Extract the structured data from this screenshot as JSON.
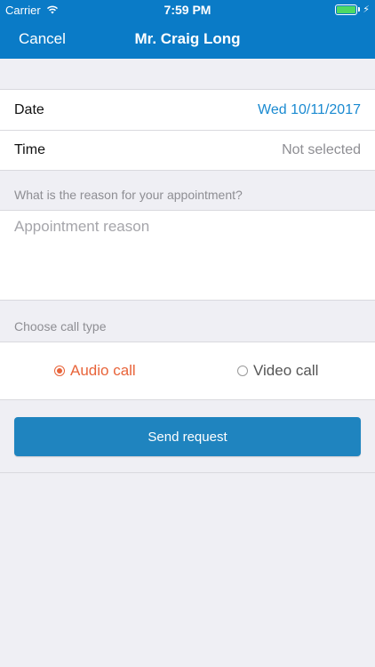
{
  "status_bar": {
    "carrier": "Carrier",
    "time": "7:59 PM",
    "icons": {
      "wifi": "wifi-icon",
      "battery": "battery-icon",
      "charging": "charging-bolt-icon"
    }
  },
  "nav": {
    "cancel_label": "Cancel",
    "title": "Mr. Craig Long"
  },
  "details": {
    "date_label": "Date",
    "date_value": "Wed 10/11/2017",
    "time_label": "Time",
    "time_value": "Not selected"
  },
  "reason": {
    "section_label": "What is the reason for your appointment?",
    "placeholder": "Appointment reason",
    "value": ""
  },
  "call_type": {
    "section_label": "Choose call type",
    "options": [
      {
        "label": "Audio call",
        "selected": true
      },
      {
        "label": "Video call",
        "selected": false
      }
    ]
  },
  "send_button_label": "Send request",
  "colors": {
    "brand": "#0a7bc7",
    "date_link": "#1a8ad1",
    "selected_radio": "#e8643a",
    "button": "#1f84bf",
    "background": "#efeff4"
  }
}
